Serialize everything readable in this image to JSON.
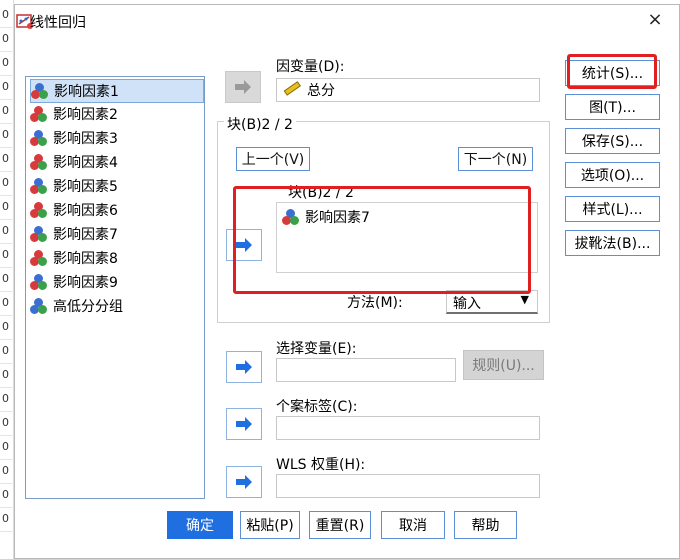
{
  "background_sheet": {
    "row_values": [
      "0",
      "0",
      "0",
      "0",
      "0",
      "0",
      "0",
      "0",
      "0",
      "0",
      "0",
      "0",
      "0",
      "0",
      "0",
      "0",
      "0",
      "0",
      "0",
      "0",
      "0",
      "0"
    ]
  },
  "dialog": {
    "title": "线性回归",
    "close_glyph": "×"
  },
  "variables": [
    {
      "label": "影响因素1",
      "selected": true
    },
    {
      "label": "影响因素2"
    },
    {
      "label": "影响因素3"
    },
    {
      "label": "影响因素4"
    },
    {
      "label": "影响因素5"
    },
    {
      "label": "影响因素6"
    },
    {
      "label": "影响因素7"
    },
    {
      "label": "影响因素8"
    },
    {
      "label": "影响因素9"
    },
    {
      "label": "高低分分组"
    }
  ],
  "dependent": {
    "label": "因变量(D):",
    "value": "总分"
  },
  "block": {
    "group_label": "块(B)2 / 2",
    "inner_label": "块(B)2 / 2",
    "prev_label": "上一个(V)",
    "next_label": "下一个(N)",
    "items": [
      "影响因素7"
    ]
  },
  "method": {
    "label": "方法(M):",
    "value": "输入"
  },
  "selection": {
    "label": "选择变量(E):",
    "rule_button": "规则(U)..."
  },
  "case_label": {
    "label": "个案标签(C):"
  },
  "wls": {
    "label": "WLS 权重(H):"
  },
  "side_buttons": [
    "统计(S)...",
    "图(T)...",
    "保存(S)...",
    "选项(O)...",
    "样式(L)...",
    "拔靴法(B)..."
  ],
  "bottom_buttons": [
    "确定",
    "粘贴(P)",
    "重置(R)",
    "取消",
    "帮助"
  ],
  "colors": {
    "accent": "#1f6fe0",
    "highlight_box": "#e02020",
    "arrow_blue": "#1f6fe0"
  }
}
